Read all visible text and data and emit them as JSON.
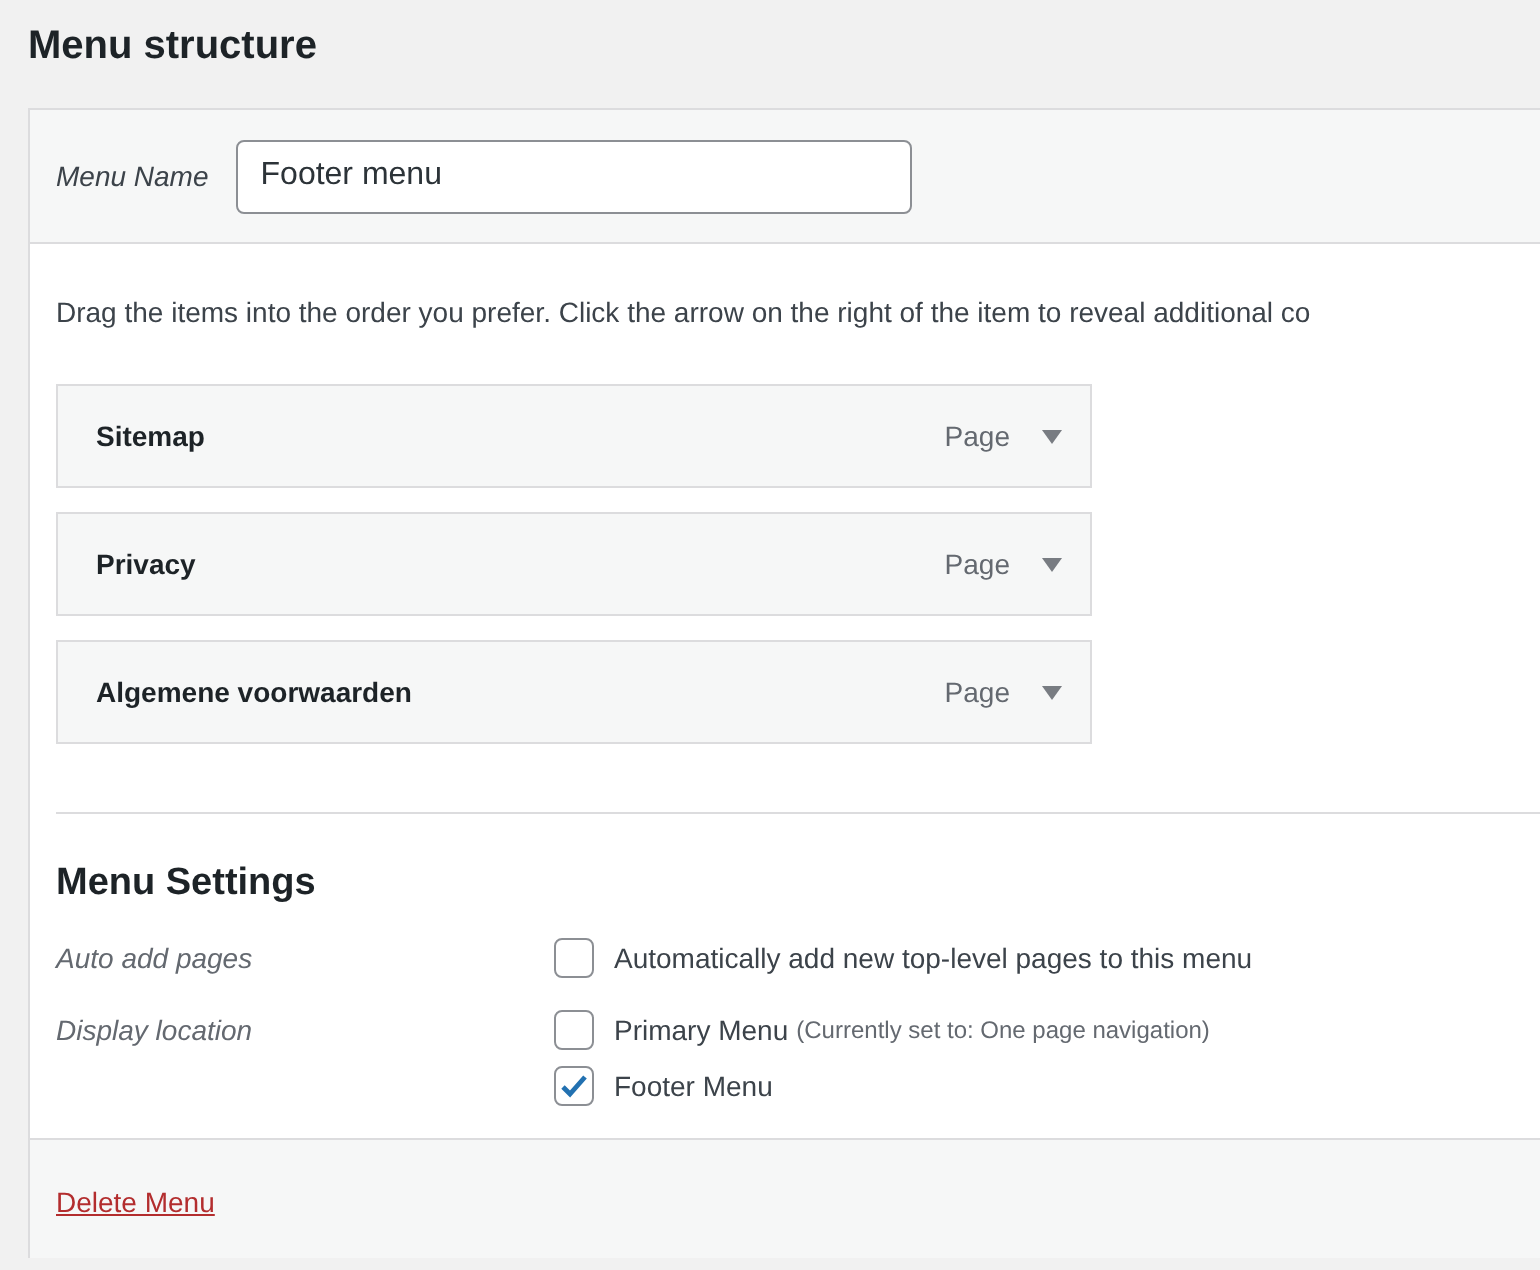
{
  "title": "Menu structure",
  "menu_name": {
    "label": "Menu Name",
    "value": "Footer menu"
  },
  "instructions": "Drag the items into the order you prefer. Click the arrow on the right of the item to reveal additional co",
  "items": [
    {
      "title": "Sitemap",
      "type": "Page"
    },
    {
      "title": "Privacy",
      "type": "Page"
    },
    {
      "title": "Algemene voorwaarden",
      "type": "Page"
    }
  ],
  "settings": {
    "heading": "Menu Settings",
    "rows": [
      {
        "label": "Auto add pages",
        "options": [
          {
            "label": "Automatically add new top-level pages to this menu",
            "checked": false
          }
        ]
      },
      {
        "label": "Display location",
        "options": [
          {
            "label": "Primary Menu",
            "note": "(Currently set to: One page navigation)",
            "checked": false
          },
          {
            "label": "Footer Menu",
            "checked": true
          }
        ]
      }
    ]
  },
  "delete_link": "Delete Menu"
}
